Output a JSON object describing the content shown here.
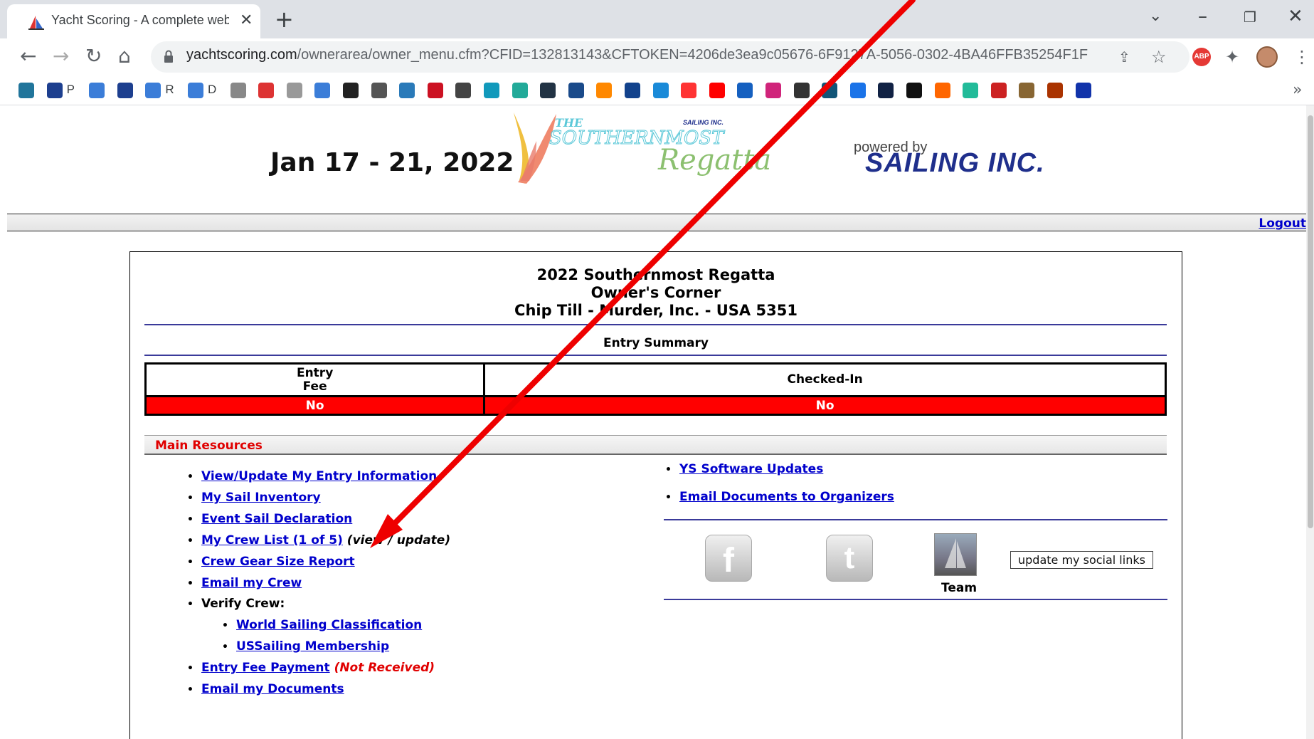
{
  "browser": {
    "tab_title": "Yacht Scoring - A complete web",
    "url_host": "yachtscoring.com",
    "url_path": "/ownerarea/owner_menu.cfm?CFID=132813143&CFTOKEN=4206de3ea9c05676-6F9127",
    "url_path_tail": "A-5056-0302-4BA46FFB35254F1F",
    "abp_label": "ABP",
    "bookmark_letters": [
      "P",
      "R",
      "D"
    ],
    "bookmark_icons": [
      "wordpress-icon",
      "ussailing-icon",
      "sailboat-icon",
      "ussailing-icon",
      "sailboat-icon",
      "sailboat-icon",
      "flag-icon",
      "badge-icon",
      "pennant-icon",
      "sail-icon",
      "regatta-icon",
      "rn-icon",
      "sf-icon",
      "wa-icon",
      "m-icon",
      "ship-icon",
      "figure-icon",
      "wave-icon",
      "channel-icon",
      "sun-icon",
      "v-icon",
      "circle-icon",
      "nbc-icon",
      "youtube-icon",
      "sxm-icon",
      "p-icon",
      "hh-icon",
      "tree-icon",
      "z-icon",
      "boat-icon",
      "amazon-icon",
      "k-icon",
      "puzzle-icon",
      "v2-icon",
      "clock-icon",
      "ball-icon",
      "lifebuoy-icon"
    ],
    "accent": "#1a73e8"
  },
  "header": {
    "date_range": "Jan 17 - 21, 2022",
    "logo_line1": "THE",
    "logo_line2": "SOUTHERNMOST",
    "logo_line3": "Regatta",
    "logo_sponsor": "SAILING INC.",
    "powered_by": "powered by",
    "sailing_inc": "SAILING INC.",
    "logout": "Logout"
  },
  "content": {
    "title_line1": "2022 Southernmost Regatta",
    "title_line2": "Owner's Corner",
    "title_line3": "Chip Till - Murder, Inc. - USA 5351",
    "entry_summary": "Entry Summary",
    "table": {
      "col1_header_line1": "Entry",
      "col1_header_line2": "Fee",
      "col2_header": "Checked-In",
      "col1_value": "No",
      "col2_value": "No"
    },
    "main_resources": "Main Resources",
    "left_links": {
      "view_update": "View/Update My Entry Information",
      "sail_inventory": "My Sail Inventory",
      "sail_declaration": "Event Sail Declaration",
      "crew_list": "My Crew List (1 of 5)",
      "crew_list_note": "(view / update)",
      "crew_gear": "Crew Gear Size Report",
      "email_crew": "Email my Crew",
      "verify_crew": "Verify Crew:",
      "world_sailing": "World Sailing Classification",
      "ussailing": "USSailing Membership",
      "entry_fee": "Entry Fee Payment",
      "entry_fee_note": "(Not Received)",
      "email_docs": "Email my Documents"
    },
    "right_links": {
      "ys_updates": "YS Software Updates",
      "email_organizers": "Email Documents to Organizers"
    },
    "social": {
      "facebook_glyph": "f",
      "twitter_glyph": "t",
      "team_label": "Team",
      "update_button": "update my social links"
    }
  },
  "colors": {
    "link": "#0000cc",
    "alert_red": "#ff0000",
    "rule_blue": "#3a3a9a",
    "annotation_arrow": "#ee0000"
  }
}
